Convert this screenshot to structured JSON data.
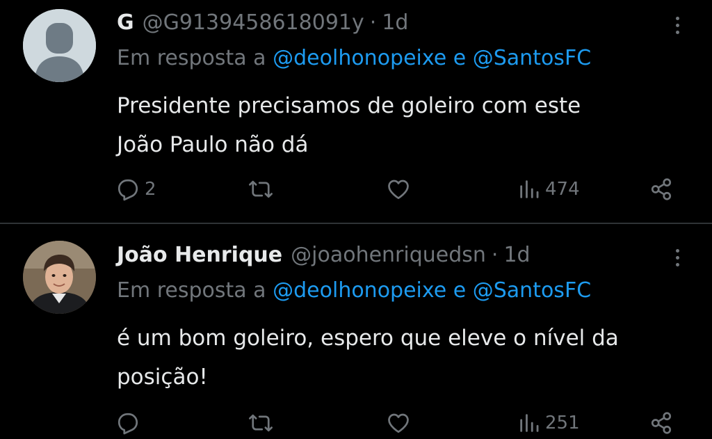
{
  "tweets": [
    {
      "display_name": "G",
      "handle": "@G9139458618091y",
      "separator": "·",
      "time": "1d",
      "reply_prefix": "Em resposta a",
      "reply_mention_1": "@deolhonopeixe",
      "reply_joiner": "e",
      "reply_mention_2": "@SantosFC",
      "text_line_1": "Presidente precisamos de goleiro com este",
      "text_line_2": "João Paulo não dá",
      "reply_count": "2",
      "views": "474",
      "avatar": "default-avatar"
    },
    {
      "display_name": "João Henrique",
      "handle": "@joaohenriquedsn",
      "separator": "·",
      "time": "1d",
      "reply_prefix": "Em resposta a",
      "reply_mention_1": "@deolhonopeixe",
      "reply_joiner": "e",
      "reply_mention_2": "@SantosFC",
      "text_line_1": "é um bom goleiro, espero que eleve o nível da",
      "text_line_2": "posição!",
      "reply_count": "",
      "views": "251",
      "avatar": "profile-photo"
    }
  ],
  "colors": {
    "background": "#000000",
    "text_primary": "#e7e9ea",
    "text_secondary": "#71767b",
    "accent": "#1d9bf0",
    "divider": "#2f3336"
  },
  "icons": [
    "more-vertical-icon",
    "reply-icon",
    "repost-icon",
    "like-icon",
    "views-icon",
    "share-icon"
  ]
}
